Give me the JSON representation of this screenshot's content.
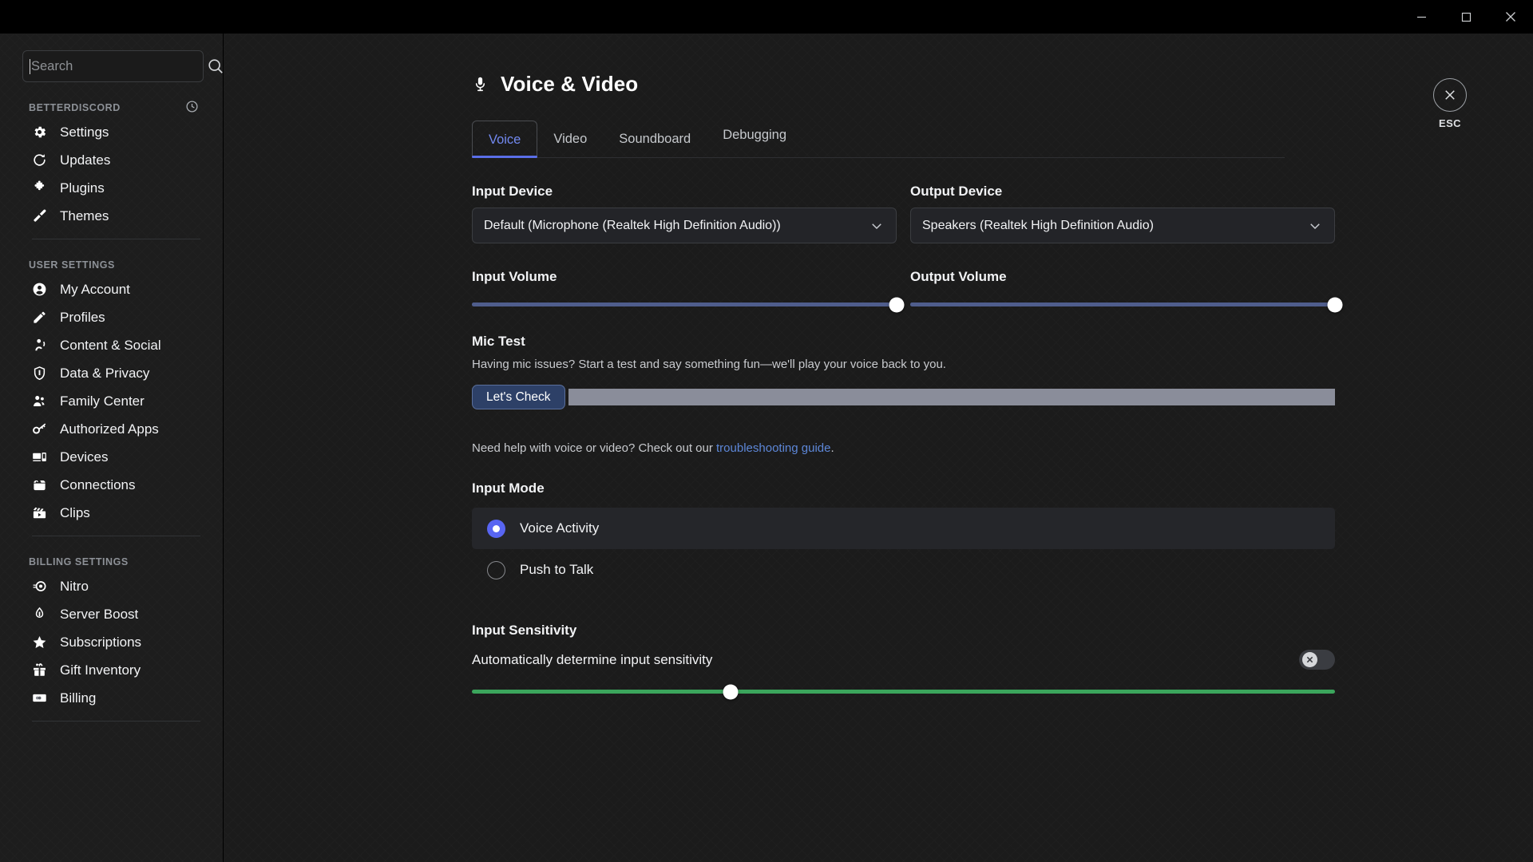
{
  "window": {
    "minimize_icon": "minimize-icon",
    "maximize_icon": "maximize-icon",
    "close_icon": "close-icon"
  },
  "sidebar": {
    "search": {
      "value": "",
      "placeholder": "Search",
      "icon": "search-icon"
    },
    "groups": [
      {
        "title": "BETTERDISCORD",
        "has_revert": true,
        "revert_icon": "history-revert-icon",
        "items": [
          {
            "label": "Settings",
            "icon": "gear-icon"
          },
          {
            "label": "Updates",
            "icon": "refresh-icon"
          },
          {
            "label": "Plugins",
            "icon": "puzzle-icon"
          },
          {
            "label": "Themes",
            "icon": "paintbrush-icon"
          }
        ]
      },
      {
        "title": "USER SETTINGS",
        "has_revert": false,
        "items": [
          {
            "label": "My Account",
            "icon": "person-circle-icon"
          },
          {
            "label": "Profiles",
            "icon": "pencil-icon"
          },
          {
            "label": "Content & Social",
            "icon": "person-wave-icon"
          },
          {
            "label": "Data & Privacy",
            "icon": "shield-icon"
          },
          {
            "label": "Family Center",
            "icon": "people-icon"
          },
          {
            "label": "Authorized Apps",
            "icon": "key-icon"
          },
          {
            "label": "Devices",
            "icon": "devices-icon"
          },
          {
            "label": "Connections",
            "icon": "connections-icon"
          },
          {
            "label": "Clips",
            "icon": "clapperboard-icon"
          }
        ]
      },
      {
        "title": "BILLING SETTINGS",
        "has_revert": false,
        "items": [
          {
            "label": "Nitro",
            "icon": "nitro-icon"
          },
          {
            "label": "Server Boost",
            "icon": "boost-gem-icon"
          },
          {
            "label": "Subscriptions",
            "icon": "star-icon"
          },
          {
            "label": "Gift Inventory",
            "icon": "gift-icon"
          },
          {
            "label": "Billing",
            "icon": "credit-card-icon"
          }
        ]
      }
    ]
  },
  "main": {
    "title": "Voice & Video",
    "title_icon": "microphone-icon",
    "tabs": [
      {
        "label": "Voice",
        "active": true
      },
      {
        "label": "Video",
        "active": false
      },
      {
        "label": "Soundboard",
        "active": false
      },
      {
        "label": "Debugging",
        "active": false
      }
    ],
    "input_device": {
      "label": "Input Device",
      "value": "Default (Microphone (Realtek High Definition Audio))",
      "chevron_icon": "chevron-down-icon"
    },
    "output_device": {
      "label": "Output Device",
      "value": "Speakers (Realtek High Definition Audio)",
      "chevron_icon": "chevron-down-icon"
    },
    "input_volume": {
      "label": "Input Volume",
      "percent": 100
    },
    "output_volume": {
      "label": "Output Volume",
      "percent": 100
    },
    "mic_test": {
      "label": "Mic Test",
      "description": "Having mic issues? Start a test and say something fun—we'll play your voice back to you.",
      "button_label": "Let's Check",
      "meter_percent": 100
    },
    "help": {
      "prefix": "Need help with voice or video? Check out our ",
      "link": "troubleshooting guide",
      "suffix": "."
    },
    "input_mode": {
      "label": "Input Mode",
      "options": [
        {
          "label": "Voice Activity",
          "selected": true
        },
        {
          "label": "Push to Talk",
          "selected": false
        }
      ]
    },
    "input_sensitivity": {
      "label": "Input Sensitivity",
      "auto_label": "Automatically determine input sensitivity",
      "toggle_on": false,
      "toggle_icon": "x-icon",
      "percent": 30
    }
  },
  "esc": {
    "label": "ESC",
    "icon": "close-icon"
  },
  "colors": {
    "accent_blue": "#5865f2",
    "tab_active": "#7289f0",
    "slider_blue": "#4f5d8c",
    "sensitivity_green": "#3ba55c",
    "link_blue": "#5d87d8",
    "button_blue": "#2d4067"
  }
}
